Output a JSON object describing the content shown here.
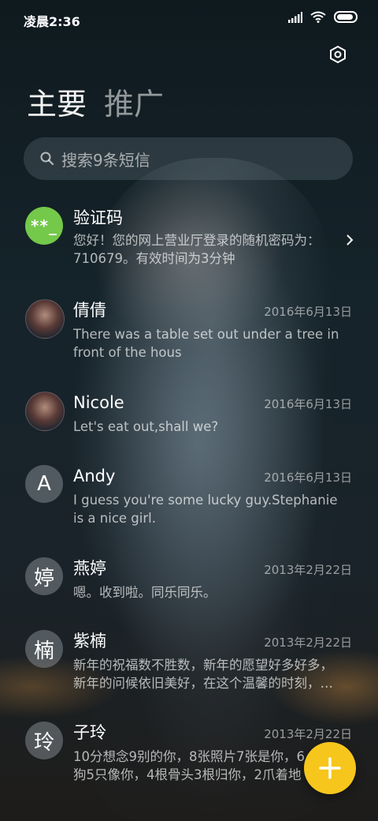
{
  "status_bar": {
    "time": "凌晨2:36",
    "icons": [
      "signal-icon",
      "wifi-icon",
      "battery-icon"
    ]
  },
  "header": {
    "settings_icon": "settings-hexagon-icon",
    "tabs": [
      {
        "label": "主要",
        "active": true
      },
      {
        "label": "推广",
        "active": false
      }
    ]
  },
  "search": {
    "placeholder": "搜索9条短信"
  },
  "messages": [
    {
      "name": "验证码",
      "avatar_text": "**_",
      "avatar_type": "green",
      "date": "",
      "preview": "您好！您的网上营业厅登录的随机密码为：\n710679。有效时间为3分钟",
      "has_chevron": true
    },
    {
      "name": "倩倩",
      "avatar_text": "",
      "avatar_type": "photo",
      "date": "2016年6月13日",
      "preview": "There was a table set out under a tree in\nfront of the hous"
    },
    {
      "name": "Nicole",
      "avatar_text": "",
      "avatar_type": "photo",
      "date": "2016年6月13日",
      "preview": "Let's eat out,shall we?"
    },
    {
      "name": "Andy",
      "avatar_text": "A",
      "avatar_type": "letter",
      "date": "2016年6月13日",
      "preview": "I guess you're some lucky guy.Stephanie\nis a nice girl."
    },
    {
      "name": "燕婷",
      "avatar_text": "婷",
      "avatar_type": "letter",
      "date": "2013年2月22日",
      "preview": "嗯。收到啦。同乐同乐。"
    },
    {
      "name": "紫楠",
      "avatar_text": "楠",
      "avatar_type": "letter",
      "date": "2013年2月22日",
      "preview": "新年的祝福数不胜数，新年的愿望好多好多，\n新年的问候依旧美好，在这个温馨的时刻，…"
    },
    {
      "name": "子玲",
      "avatar_text": "玲",
      "avatar_type": "letter",
      "date": "2013年2月22日",
      "preview": "10分想念9别的你，8张照片7张是你，6\n狗5只像你，4根骨头3根归你，2爪着地"
    }
  ],
  "fab": {
    "icon": "plus-icon"
  },
  "colors": {
    "accent": "#f7c61c",
    "green_avatar": "#74c84a"
  }
}
